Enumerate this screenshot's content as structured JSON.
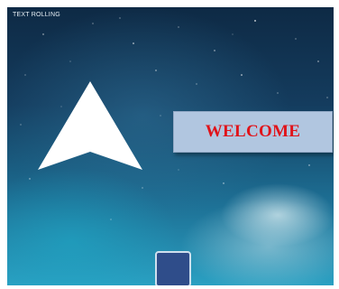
{
  "screen": {
    "title": "TEXT ROLLING",
    "banner_text": "WELCOME",
    "icons": {
      "arrow": "arrow-up-icon",
      "button": "square-button"
    },
    "colors": {
      "banner_background": "#b1c6e0",
      "banner_text": "#e0131a",
      "button_fill": "#2f4d8a",
      "arrow_fill": "#ffffff"
    }
  }
}
